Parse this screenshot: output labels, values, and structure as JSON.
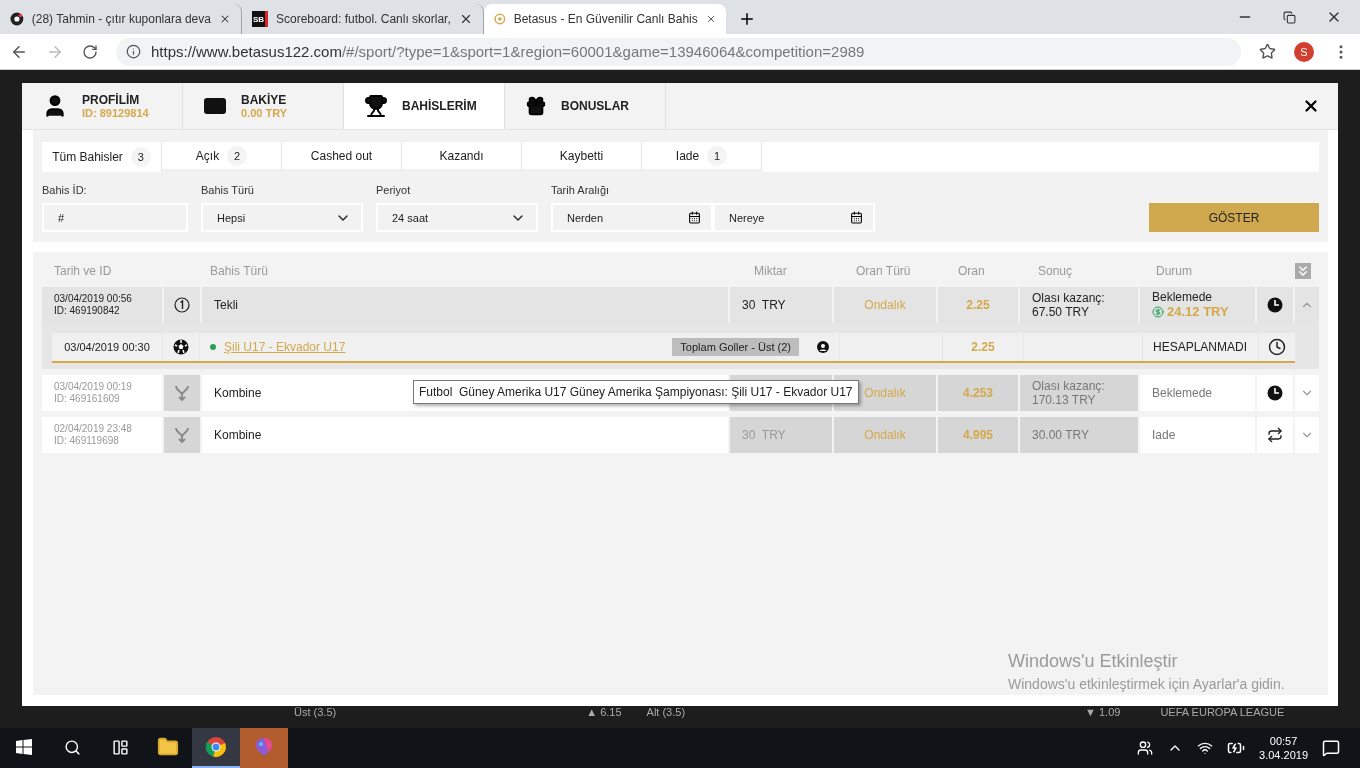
{
  "browser": {
    "tabs": [
      {
        "title": "(28) Tahmin - çıtır kuponlara deva",
        "selected": false
      },
      {
        "title": "Scoreboard: futbol. Canlı skorlar,",
        "favicon_text": "SB",
        "selected": false
      },
      {
        "title": "Betasus - En Güvenilir Canlı Bahis",
        "selected": true
      }
    ],
    "url_host": "https://www.betasus122.com",
    "url_path": "/#/sport/?type=1&sport=1&region=60001&game=13946064&competition=2989",
    "avatar": "S"
  },
  "modal": {
    "nav": [
      {
        "label": "PROFİLİM",
        "sub": "ID: 89129814",
        "selected": false
      },
      {
        "label": "BAKİYE",
        "sub": "0.00 TRY",
        "selected": false
      },
      {
        "label": "BAHİSLERİM",
        "selected": true
      },
      {
        "label": "BONUSLAR",
        "selected": false
      }
    ],
    "subtabs": [
      {
        "label": "Tüm Bahisler",
        "count": "3",
        "selected": true
      },
      {
        "label": "Açık",
        "count": "2",
        "selected": false
      },
      {
        "label": "Cashed out",
        "selected": false
      },
      {
        "label": "Kazandı",
        "selected": false
      },
      {
        "label": "Kaybetti",
        "selected": false
      },
      {
        "label": "Iade",
        "count": "1",
        "selected": false
      }
    ],
    "filters": [
      {
        "label": "Bahis İD:",
        "placeholder": "#",
        "kind": "text"
      },
      {
        "label": "Bahis Türü",
        "value": "Hepsi",
        "kind": "select"
      },
      {
        "label": "Periyot",
        "value": "24 saat",
        "kind": "select"
      },
      {
        "label": "Tarih Aralığı",
        "placeholder": "Nerden",
        "kind": "date"
      },
      {
        "placeholder": "Nereye",
        "kind": "date"
      }
    ],
    "submit": "GÖSTER",
    "table": {
      "columns": [
        "Tarih ve ID",
        "Bahis Türü",
        "Miktar",
        "Oran Türü",
        "Oran",
        "Sonuç",
        "Durum"
      ],
      "rows": [
        {
          "date": "03/04/2019 00:56",
          "id": "ID: 469190842",
          "kind": "single",
          "type": "Tekli",
          "amount": "30  TRY",
          "odds_type": "Ondalık",
          "odds": "2.25",
          "result": [
            "Olası kazanç:",
            "67.50 TRY"
          ],
          "status": "Beklemede",
          "cashout": "24.12 TRY",
          "refunded": false,
          "expanded": true,
          "selections": [
            {
              "date": "03/04/2019 00:30",
              "match": "Şili U17 - Ekvador U17",
              "market": "Toplam Goller - Üst (2)",
              "odds": "2.25",
              "status": "HESAPLANMADI"
            }
          ]
        },
        {
          "date": "03/04/2019 00:19",
          "id": "ID: 469161609",
          "kind": "combo",
          "type": "Kombine",
          "odds_type": "Ondalık",
          "odds": "4.253",
          "result": [
            "Olası kazanç:",
            "170.13 TRY"
          ],
          "status": "Beklemede",
          "refunded": false,
          "expanded": false
        },
        {
          "date": "02/04/2019 23:48",
          "id": "ID: 469119698",
          "kind": "combo",
          "type": "Kombine",
          "amount": "30  TRY",
          "odds_type": "Ondalık",
          "odds": "4.995",
          "result": [
            "30.00 TRY"
          ],
          "status": "Iade",
          "refunded": true,
          "expanded": false
        }
      ],
      "tooltip": "Futbol  Güney Amerika U17 Güney Amerika Şampiyonası: Şili U17 - Ekvador U17"
    }
  },
  "background_strip": [
    "Üst (3.5)",
    "▲ 6.15",
    "Alt (3.5)",
    "▼ 1.09",
    "UEFA EUROPA LEAGUE"
  ],
  "activation": {
    "title": "Windows'u Etkinleştir",
    "text": "Windows'u etkinleştirmek için Ayarlar'a gidin."
  },
  "taskbar": {
    "apps": [
      {
        "kind": "folder",
        "selected": false,
        "flashing": false
      },
      {
        "kind": "chrome",
        "selected": true,
        "flashing": false
      },
      {
        "kind": "paint",
        "selected": false,
        "flashing": true
      }
    ],
    "time": "00:57",
    "date": "3.04.2019"
  }
}
